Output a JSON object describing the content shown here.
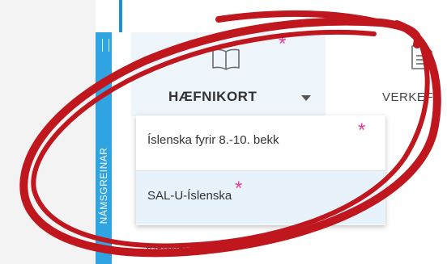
{
  "sidebar_tab": {
    "label": "NÁMSGREINAR"
  },
  "toolbar": {
    "tabs": [
      {
        "label": "HÆFNIKORT",
        "icon": "book-icon"
      },
      {
        "label": "VERKEF",
        "icon": "document-icon"
      }
    ]
  },
  "dropdown": {
    "items": [
      {
        "label": "Íslenska fyrir 8.-10. bekk"
      },
      {
        "label": "SAL-U-Íslenska"
      }
    ]
  },
  "below_menu": {
    "label": "VIÐMIÐ"
  },
  "annotations": {
    "star_glyph": "*",
    "star_color": "#ec3a9a",
    "circle_color": "#c0161d"
  },
  "colors": {
    "accent": "#30a4e0",
    "selected_bg": "#e8f2fa"
  }
}
